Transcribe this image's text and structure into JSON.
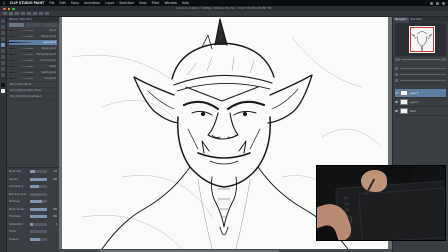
{
  "menubar": {
    "items": [
      "CLIP STUDIO PAINT",
      "File",
      "Edit",
      "Story",
      "Animation",
      "Layer",
      "Selection",
      "View",
      "Filter",
      "Window",
      "Help"
    ]
  },
  "window": {
    "title": "Comic1 (1920 x 1080px 300dpi 25.0%) - CLIP STUDIO PAINT EX"
  },
  "left_panel": {
    "title": "Pencil / Sub Tool",
    "brushes": [
      {
        "name": "Pencil",
        "selected": false
      },
      {
        "name": "Design pencil",
        "selected": false
      },
      {
        "name": "Light pencil",
        "selected": true
      },
      {
        "name": "Rough pencil",
        "selected": false
      },
      {
        "name": "Mechanical pencil",
        "selected": false
      },
      {
        "name": "Colored pencil",
        "selected": false
      },
      {
        "name": "Pastel",
        "selected": false
      },
      {
        "name": "Sketch pencil",
        "selected": false
      },
      {
        "name": "Fine pencil",
        "selected": false
      },
      {
        "name": "Perry's Pencil Brush",
        "selected": false,
        "text_only": true
      },
      {
        "name": "Perry's Textured Pencil Brush",
        "selected": false,
        "text_only": true
      },
      {
        "name": "Perry Pencil Brush Settings 2",
        "selected": false,
        "text_only": true
      }
    ],
    "properties": [
      {
        "label": "Brush Size",
        "value": "3.0",
        "level": 0.3
      },
      {
        "label": "Opacity",
        "value": "100",
        "level": 1.0
      },
      {
        "label": "Anti-aliasing",
        "value": "",
        "level": 0.5
      },
      {
        "label": "Blending mode",
        "value": "",
        "level": 0.0
      },
      {
        "label": "Hardness",
        "value": "",
        "level": 0.7
      },
      {
        "label": "Brush density",
        "value": "100",
        "level": 1.0
      },
      {
        "label": "Thickness",
        "value": "100",
        "level": 1.0
      },
      {
        "label": "Stabilization",
        "value": "3",
        "level": 0.2
      },
      {
        "label": "Vector",
        "value": "",
        "level": 0.0
      },
      {
        "label": "Pressure",
        "value": "",
        "level": 0.6
      }
    ]
  },
  "right_panel": {
    "tabs": [
      "Navigator",
      "Sub View"
    ],
    "layers": [
      {
        "name": "Layer 3",
        "selected": true
      },
      {
        "name": "Layer 2",
        "selected": false
      },
      {
        "name": "Paper",
        "selected": false
      }
    ]
  },
  "icons": {
    "apple": "apple-icon",
    "close": "close-dot-icon",
    "minimize": "minimize-dot-icon",
    "zoom": "zoom-dot-icon",
    "eye": "eye-icon"
  },
  "colors": {
    "accent_selection": "#5e7fa3",
    "traffic_red": "#ff5f57",
    "traffic_yellow": "#febc2e",
    "traffic_green": "#28c840",
    "navigator_frame": "#d8373a"
  }
}
